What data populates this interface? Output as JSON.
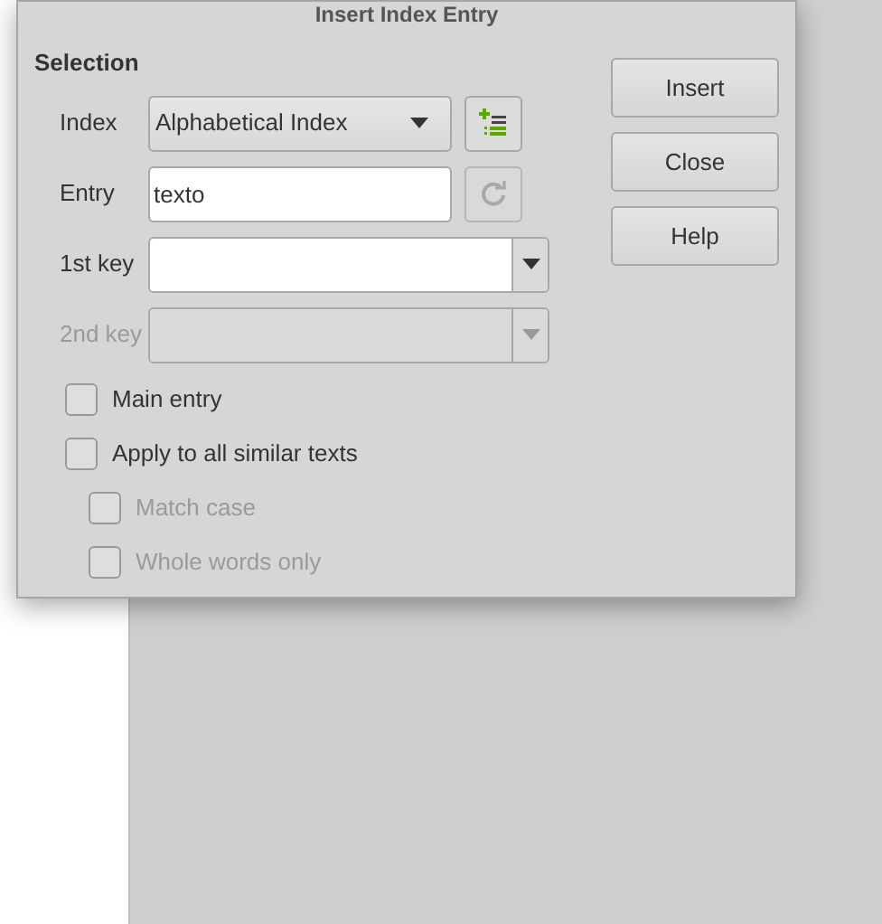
{
  "window": {
    "title": "Insert Index Entry"
  },
  "section_title": "Selection",
  "fields": [
    {
      "kind": "dropdown",
      "label": "Index",
      "value": "Alphabetical Index",
      "disabled": false
    },
    {
      "kind": "text",
      "label": "Entry",
      "value": "texto",
      "disabled": false
    },
    {
      "kind": "combo",
      "label": "1st key",
      "disabled": false
    },
    {
      "kind": "combo",
      "label": "2nd key",
      "disabled": true
    }
  ],
  "checkboxes": [
    {
      "label": "Main entry",
      "checked": false,
      "disabled": false
    },
    {
      "label": "Apply to all similar texts",
      "checked": false,
      "disabled": false,
      "children": [
        {
          "label": "Match case",
          "checked": false,
          "disabled": true
        },
        {
          "label": "Whole words only",
          "checked": false,
          "disabled": true
        }
      ]
    }
  ],
  "buttons": [
    "Insert",
    "Close",
    "Help"
  ]
}
